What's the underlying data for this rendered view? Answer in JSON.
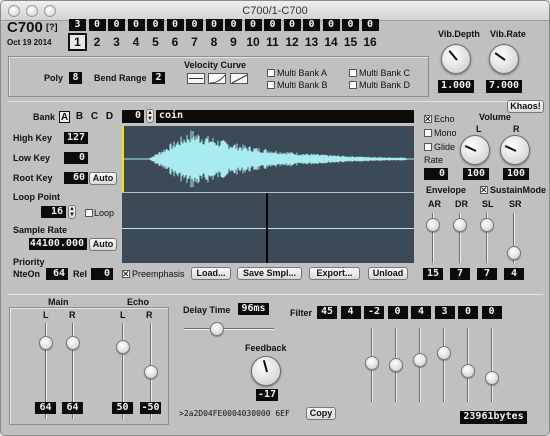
{
  "window": {
    "title": "C700/1-C700"
  },
  "header": {
    "app_name": "C700",
    "help": "[?]",
    "date": "Oct 19 2014"
  },
  "tracks": {
    "counts": [
      "3",
      "0",
      "0",
      "0",
      "0",
      "0",
      "0",
      "0",
      "0",
      "0",
      "0",
      "0",
      "0",
      "0",
      "0",
      "0"
    ],
    "numbers": [
      "1",
      "2",
      "3",
      "4",
      "5",
      "6",
      "7",
      "8",
      "9",
      "10",
      "11",
      "12",
      "13",
      "14",
      "15",
      "16"
    ],
    "selected": "1"
  },
  "vibrato": {
    "depth_label": "Vib.Depth",
    "rate_label": "Vib.Rate",
    "depth_value": "1.000",
    "rate_value": "7.000"
  },
  "poly": {
    "label": "Poly",
    "value": "8"
  },
  "bend_range": {
    "label": "Bend Range",
    "value": "2"
  },
  "velocity_curve": {
    "label": "Velocity Curve"
  },
  "multibank": {
    "a": "Multi Bank A",
    "b": "Multi Bank B",
    "c": "Multi Bank C",
    "d": "Multi Bank D"
  },
  "bank": {
    "label": "Bank",
    "letters": [
      "A",
      "B",
      "C",
      "D"
    ],
    "selected": "A"
  },
  "program": {
    "number": "0",
    "name": "coin"
  },
  "khaos_button": "Khaos!",
  "high_key": {
    "label": "High Key",
    "value": "127"
  },
  "low_key": {
    "label": "Low Key",
    "value": "0"
  },
  "root_key": {
    "label": "Root Key",
    "value": "60",
    "auto": "Auto"
  },
  "loop_point": {
    "label": "Loop Point",
    "value": "16",
    "loop_label": "Loop"
  },
  "sample_rate": {
    "label": "Sample Rate",
    "value": "44100.000",
    "auto": "Auto"
  },
  "priority": {
    "label": "Priority",
    "nteon_label": "NteOn",
    "nteon_value": "64",
    "rel_label": "Rel",
    "rel_value": "0"
  },
  "preemphasis": "Preemphasis",
  "buttons": {
    "load": "Load...",
    "save": "Save Smpl...",
    "export": "Export...",
    "unload": "Unload"
  },
  "channel": {
    "echo": "Echo",
    "mono": "Mono",
    "glide": "Glide",
    "rate_label": "Rate",
    "rate_value": "0",
    "volume_label": "Volume",
    "l_label": "L",
    "r_label": "R",
    "vol_l": "100",
    "vol_r": "100"
  },
  "envelope": {
    "label": "Envelope",
    "sustain_mode": "SustainMode",
    "labels": [
      "AR",
      "DR",
      "SL",
      "SR"
    ],
    "values": [
      "15",
      "7",
      "7",
      "4"
    ]
  },
  "main": {
    "label": "Main",
    "l_label": "L",
    "r_label": "R",
    "l_value": "64",
    "r_value": "64"
  },
  "echo_mix": {
    "label": "Echo",
    "l_label": "L",
    "r_label": "R",
    "l_value": "50",
    "r_value": "-50"
  },
  "delay_time": {
    "label": "Delay Time",
    "value": "96ms"
  },
  "feedback": {
    "label": "Feedback",
    "value": "-17"
  },
  "filter": {
    "label": "Filter",
    "values": [
      "45",
      "4",
      "-2",
      "0",
      "4",
      "3",
      "0",
      "0"
    ]
  },
  "hex_string": ">2a2D04FE0004030000 6EF",
  "copy_button": "Copy",
  "bytes": "23961bytes",
  "colors": {
    "wave": "#a8ecf0",
    "display_bg": "#3c4a58",
    "marker": "#e8e800"
  }
}
